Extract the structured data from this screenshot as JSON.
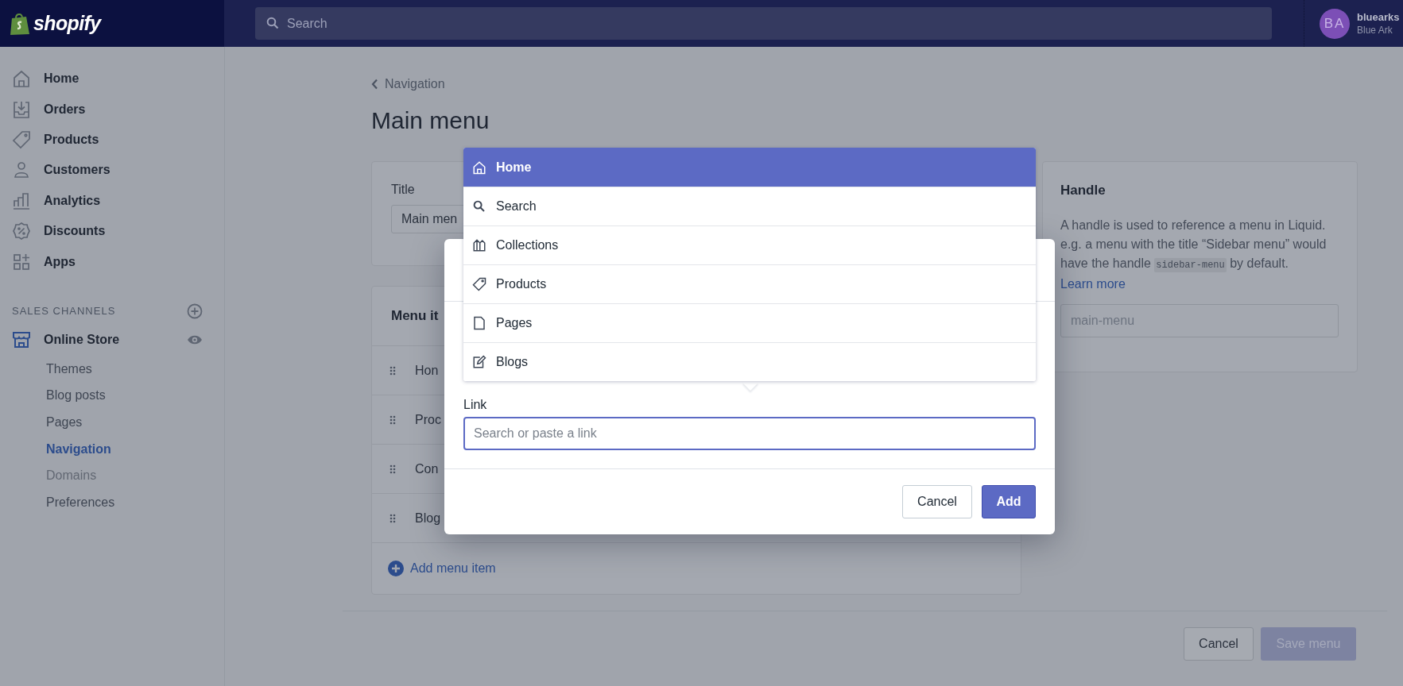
{
  "topbar": {
    "logo": "shopify",
    "search": {
      "placeholder": "Search"
    },
    "account": {
      "initials": "BA",
      "name": "bluearks",
      "store": "Blue Ark"
    }
  },
  "sidebar": {
    "items": [
      {
        "label": "Home",
        "selected": false
      },
      {
        "label": "Orders",
        "selected": false
      },
      {
        "label": "Products",
        "selected": false
      },
      {
        "label": "Customers",
        "selected": false
      },
      {
        "label": "Analytics",
        "selected": false
      },
      {
        "label": "Discounts",
        "selected": false
      },
      {
        "label": "Apps",
        "selected": false
      }
    ],
    "sales_channels": {
      "heading": "SALES CHANNELS",
      "channel": {
        "label": "Online Store",
        "selected": true,
        "children": [
          {
            "label": "Themes",
            "selected": false,
            "disabled": false
          },
          {
            "label": "Blog posts",
            "selected": false,
            "disabled": false
          },
          {
            "label": "Pages",
            "selected": false,
            "disabled": false
          },
          {
            "label": "Navigation",
            "selected": true,
            "disabled": false
          },
          {
            "label": "Domains",
            "selected": false,
            "disabled": true
          },
          {
            "label": "Preferences",
            "selected": false,
            "disabled": false
          }
        ]
      }
    }
  },
  "page": {
    "back_link": "Navigation",
    "title": "Main menu",
    "title_card": {
      "label": "Title",
      "value": "Main men"
    },
    "menu_items_card": {
      "heading": "Menu it",
      "items": [
        "Hon",
        "Proc",
        "Con",
        "Blog"
      ],
      "add_link": "Add menu item"
    },
    "handle_card": {
      "heading": "Handle",
      "description_before": "A handle is used to reference a menu in Liquid. e.g. a menu with the title “Sidebar menu” would have the handle ",
      "code": "sidebar-menu",
      "description_after": " by default. ",
      "link": "Learn more",
      "value": "main-menu"
    },
    "footer": {
      "cancel": "Cancel",
      "save": {
        "label": "Save menu",
        "disabled": true
      }
    }
  },
  "modal": {
    "link_label": "Link",
    "link_field": {
      "placeholder": "Search or paste a link"
    },
    "cancel": "Cancel",
    "add": "Add",
    "dropdown": [
      {
        "label": "Home",
        "selected": true
      },
      {
        "label": "Search",
        "selected": false
      },
      {
        "label": "Collections",
        "selected": false
      },
      {
        "label": "Products",
        "selected": false
      },
      {
        "label": "Pages",
        "selected": false
      },
      {
        "label": "Blogs",
        "selected": false
      }
    ]
  }
}
